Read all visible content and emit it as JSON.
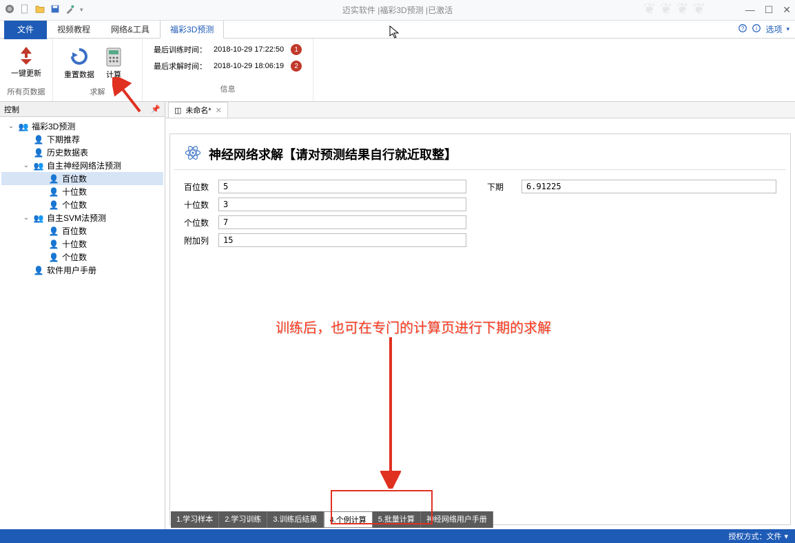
{
  "titlebar": {
    "app_title": "迈实软件 |福彩3D预测 |已激活"
  },
  "ribbon": {
    "tabs": {
      "file": "文件",
      "video": "视频教程",
      "net": "网络&工具",
      "pred": "福彩3D预测"
    },
    "right": {
      "options": "选项"
    },
    "groups": {
      "g1": {
        "btn1": "一键更新",
        "label": "所有页数据"
      },
      "g2": {
        "btn1": "重置数据",
        "btn2": "计算",
        "label": "求解"
      },
      "info": {
        "train_label": "最后训练时间：",
        "train_time": "2018-10-29 17:22:50",
        "solve_label": "最后求解时间：",
        "solve_time": "2018-10-29 18:06:19",
        "label": "信息"
      }
    }
  },
  "sidebar": {
    "header": "控制",
    "nodes": {
      "n0": "福彩3D预测",
      "n1": "下期推荐",
      "n2": "历史数据表",
      "n3": "自主神经网络法预测",
      "n4": "百位数",
      "n5": "十位数",
      "n6": "个位数",
      "n7": "自主SVM法预测",
      "n8": "百位数",
      "n9": "十位数",
      "n10": "个位数",
      "n11": "软件用户手册"
    }
  },
  "doc": {
    "tab_title": "未命名*",
    "page_title": "神经网络求解【请对预测结果自行就近取整】",
    "form": {
      "bai_label": "百位数",
      "bai_val": "5",
      "shi_label": "十位数",
      "shi_val": "3",
      "ge_label": "个位数",
      "ge_val": "7",
      "fu_label": "附加列",
      "fu_val": "15",
      "next_label": "下期",
      "next_val": "6.91225"
    }
  },
  "bottom_tabs": {
    "t1": "1.学习样本",
    "t2": "2.学习训练",
    "t3": "3.训练后结果",
    "t4": "4.个例计算",
    "t5": "5.批量计算",
    "t6": "神经网络用户手册"
  },
  "annotation": {
    "text": "训练后，也可在专门的计算页进行下期的求解"
  },
  "statusbar": {
    "auth": "授权方式：文件"
  }
}
